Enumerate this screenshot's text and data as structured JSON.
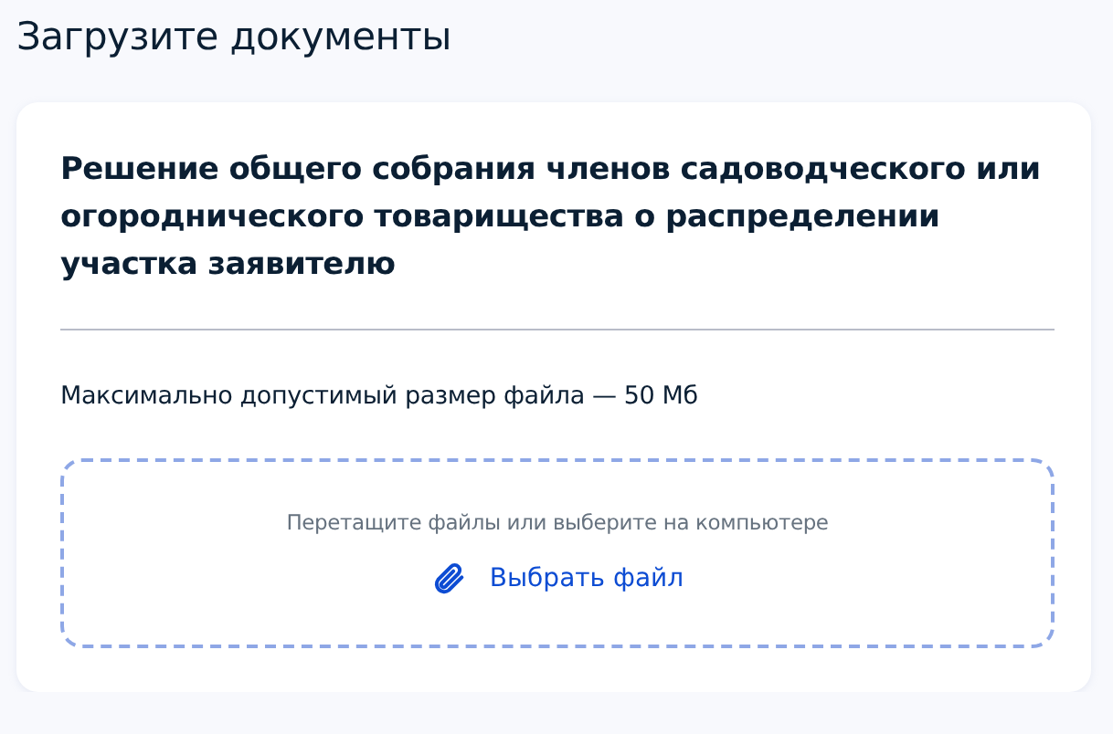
{
  "page_title": "Загрузите документы",
  "document": {
    "title": "Решение общего собрания членов садоводческого или огороднического товарищества о распределении участка заявителю",
    "size_limit": "Максимально допустимый размер файла — 50 Мб",
    "dropzone": {
      "hint": "Перетащите файлы или выберите на компьютере",
      "button": "Выбрать файл"
    }
  }
}
